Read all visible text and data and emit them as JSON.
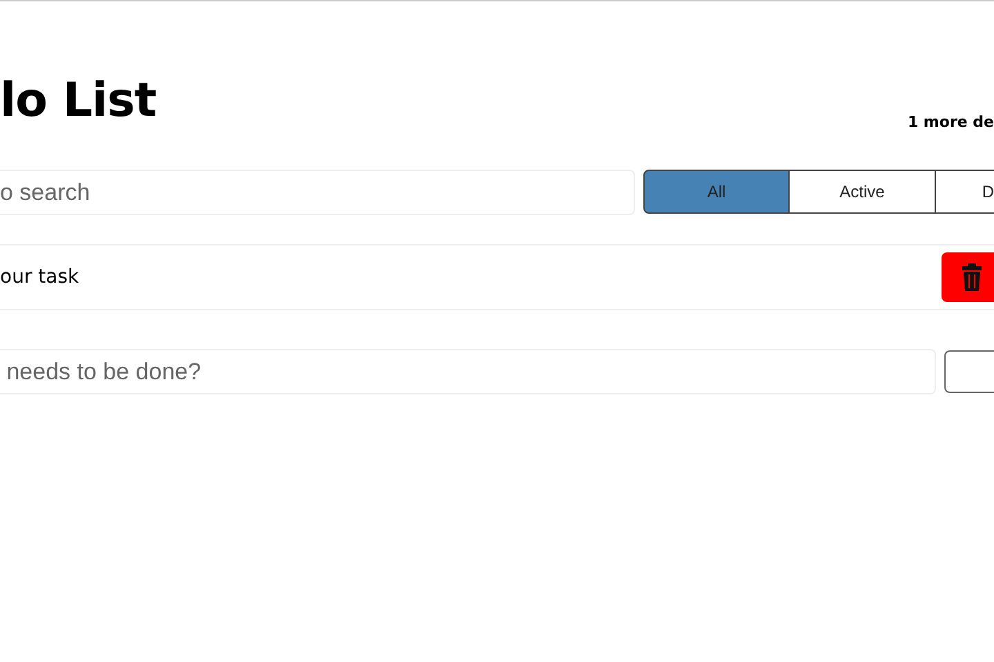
{
  "title": "lo List",
  "remaining": "1 more de",
  "search": {
    "placeholder": "o search"
  },
  "filters": [
    {
      "label": "All",
      "selected": true
    },
    {
      "label": "Active",
      "selected": false
    },
    {
      "label": "D",
      "selected": false
    }
  ],
  "tasks": [
    {
      "text": "our task"
    }
  ],
  "new_task": {
    "placeholder": " needs to be done?"
  }
}
